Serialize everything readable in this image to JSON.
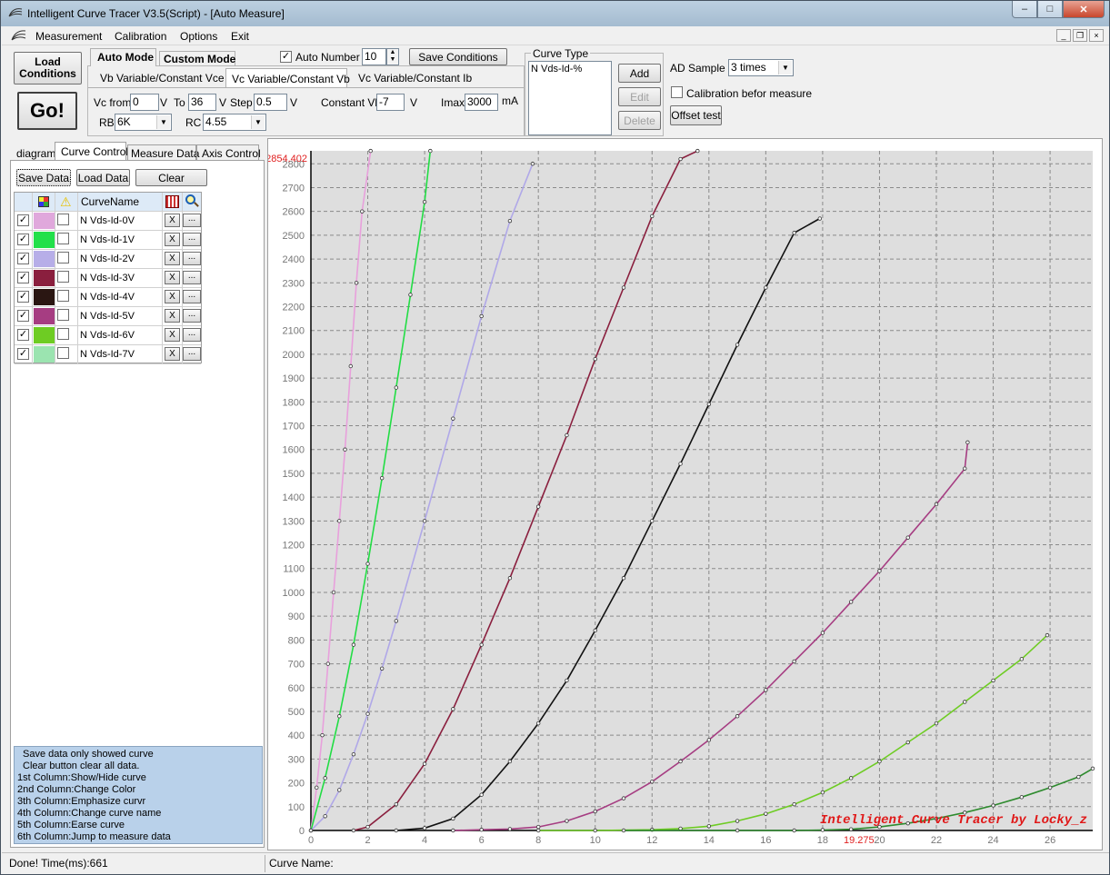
{
  "window": {
    "title": "Intelligent Curve Tracer V3.5(Script) - [Auto Measure]"
  },
  "menu": [
    "Measurement",
    "Calibration",
    "Options",
    "Exit"
  ],
  "toolbar": {
    "load_conditions": "Load Conditions",
    "go": "Go!",
    "auto_mode": "Auto Mode",
    "custom_mode": "Custom Mode",
    "auto_number_label": "Auto Number",
    "auto_number_checked": true,
    "auto_number_value": "10",
    "save_conditions": "Save Conditions",
    "subtabs": [
      "Vb Variable/Constant Vce",
      "Vc Variable/Constant Vb",
      "Vc Variable/Constant Ib"
    ],
    "vc_from_label": "Vc from",
    "vc_from": "0",
    "v1": "V",
    "to_label": "To",
    "to": "36",
    "v2": "V",
    "step_label": "Step",
    "step": "0.5",
    "v3": "V",
    "constant_vb_label": "Constant Vb",
    "constant_vb": "-7",
    "v4": "V",
    "imax_label": "Imax",
    "imax": "3000",
    "ma": "mA",
    "rb_label": "RB",
    "rb": "6K",
    "rc_label": "RC",
    "rc": "4.55"
  },
  "curve_type": {
    "label": "Curve Type",
    "items": [
      "N Vds-Id-%"
    ],
    "add": "Add",
    "edit": "Edit",
    "delete": "Delete"
  },
  "ad_sample": {
    "label": "AD Sample",
    "value": "3 times"
  },
  "calibration": {
    "label": "Calibration befor measure",
    "checked": false
  },
  "offset_test": "Offset test",
  "left_tabs": [
    "diagram",
    "Curve Control",
    "Measure Data",
    "Axis Control"
  ],
  "left_buttons": {
    "save": "Save Data",
    "load": "Load Data",
    "clear": "Clear"
  },
  "grid_header": {
    "name": "CurveName"
  },
  "curves": [
    {
      "name": "N Vds-Id-0V",
      "color": "#e0a8dc"
    },
    {
      "name": "N Vds-Id-1V",
      "color": "#22e04a"
    },
    {
      "name": "N Vds-Id-2V",
      "color": "#b7aee8"
    },
    {
      "name": "N Vds-Id-3V",
      "color": "#8a1f3e"
    },
    {
      "name": "N Vds-Id-4V",
      "color": "#2a1612"
    },
    {
      "name": "N Vds-Id-5V",
      "color": "#a63d82"
    },
    {
      "name": "N Vds-Id-6V",
      "color": "#6ecc23"
    },
    {
      "name": "N Vds-Id-7V",
      "color": "#9be4b0"
    }
  ],
  "grid_buttons": {
    "erase": "X",
    "jump": "..."
  },
  "help_text": [
    "Save data only showed curve",
    "Clear button clear all data.",
    "1st Column:Show/Hide curve",
    "2nd Column:Change Color",
    "3th Column:Emphasize curvr",
    "4th Column:Change curve name",
    "5th Column:Earse curve",
    "6th Column:Jump to measure data"
  ],
  "status": {
    "left": "Done!  Time(ms):661",
    "right": "Curve Name:"
  },
  "chart_data": {
    "type": "line",
    "xlim": [
      0,
      27.5
    ],
    "ylim": [
      0,
      2854.402
    ],
    "ymax_label": "2854.402",
    "cursor_x_label": "19.275",
    "watermark": "Intelligent Curve Tracer by Locky_z",
    "x_ticks": [
      0,
      2,
      4,
      6,
      8,
      10,
      12,
      14,
      16,
      18,
      20,
      22,
      24,
      26
    ],
    "y_ticks": [
      0,
      100,
      200,
      300,
      400,
      500,
      600,
      700,
      800,
      900,
      1000,
      1100,
      1200,
      1300,
      1400,
      1500,
      1600,
      1700,
      1800,
      1900,
      2000,
      2100,
      2200,
      2300,
      2400,
      2500,
      2600,
      2700,
      2800
    ],
    "series": [
      {
        "color": "#e8a0dc",
        "points": [
          [
            0,
            0
          ],
          [
            0.2,
            180
          ],
          [
            0.4,
            400
          ],
          [
            0.6,
            700
          ],
          [
            0.8,
            1000
          ],
          [
            1,
            1300
          ],
          [
            1.2,
            1600
          ],
          [
            1.4,
            1950
          ],
          [
            1.6,
            2300
          ],
          [
            1.8,
            2600
          ],
          [
            2.1,
            2854
          ]
        ]
      },
      {
        "color": "#22dd44",
        "points": [
          [
            0,
            0
          ],
          [
            0.5,
            220
          ],
          [
            1,
            480
          ],
          [
            1.5,
            780
          ],
          [
            2,
            1120
          ],
          [
            2.5,
            1480
          ],
          [
            3,
            1860
          ],
          [
            3.5,
            2250
          ],
          [
            4,
            2640
          ],
          [
            4.2,
            2854
          ]
        ]
      },
      {
        "color": "#b0a8e8",
        "points": [
          [
            0,
            0
          ],
          [
            0.5,
            60
          ],
          [
            1,
            170
          ],
          [
            1.5,
            320
          ],
          [
            2,
            490
          ],
          [
            2.5,
            680
          ],
          [
            3,
            880
          ],
          [
            4,
            1300
          ],
          [
            5,
            1730
          ],
          [
            6,
            2160
          ],
          [
            7,
            2560
          ],
          [
            7.8,
            2800
          ]
        ]
      },
      {
        "color": "#8a1f3e",
        "points": [
          [
            1.5,
            0
          ],
          [
            2,
            15
          ],
          [
            3,
            110
          ],
          [
            4,
            280
          ],
          [
            5,
            510
          ],
          [
            6,
            780
          ],
          [
            7,
            1060
          ],
          [
            8,
            1360
          ],
          [
            9,
            1660
          ],
          [
            10,
            1980
          ],
          [
            11,
            2280
          ],
          [
            12,
            2580
          ],
          [
            13,
            2820
          ],
          [
            13.6,
            2854
          ]
        ]
      },
      {
        "color": "#111111",
        "points": [
          [
            3,
            0
          ],
          [
            4,
            10
          ],
          [
            5,
            50
          ],
          [
            6,
            150
          ],
          [
            7,
            290
          ],
          [
            8,
            450
          ],
          [
            9,
            630
          ],
          [
            10,
            840
          ],
          [
            11,
            1060
          ],
          [
            12,
            1300
          ],
          [
            13,
            1540
          ],
          [
            14,
            1790
          ],
          [
            15,
            2040
          ],
          [
            16,
            2280
          ],
          [
            17,
            2510
          ],
          [
            17.9,
            2570
          ]
        ]
      },
      {
        "color": "#a63d82",
        "points": [
          [
            5,
            0
          ],
          [
            6,
            3
          ],
          [
            7,
            6
          ],
          [
            8,
            15
          ],
          [
            9,
            40
          ],
          [
            10,
            80
          ],
          [
            11,
            135
          ],
          [
            12,
            205
          ],
          [
            13,
            290
          ],
          [
            14,
            380
          ],
          [
            15,
            480
          ],
          [
            16,
            590
          ],
          [
            17,
            710
          ],
          [
            18,
            830
          ],
          [
            19,
            960
          ],
          [
            20,
            1090
          ],
          [
            21,
            1230
          ],
          [
            22,
            1370
          ],
          [
            23,
            1520
          ],
          [
            23.1,
            1630
          ]
        ]
      },
      {
        "color": "#6ecc23",
        "points": [
          [
            8,
            0
          ],
          [
            10,
            0
          ],
          [
            12,
            3
          ],
          [
            13,
            8
          ],
          [
            14,
            18
          ],
          [
            15,
            40
          ],
          [
            16,
            70
          ],
          [
            17,
            110
          ],
          [
            18,
            160
          ],
          [
            19,
            220
          ],
          [
            20,
            290
          ],
          [
            21,
            370
          ],
          [
            22,
            450
          ],
          [
            23,
            540
          ],
          [
            24,
            630
          ],
          [
            25,
            720
          ],
          [
            25.9,
            820
          ]
        ]
      },
      {
        "color": "#2e8b2e",
        "points": [
          [
            11,
            0
          ],
          [
            15,
            0
          ],
          [
            17,
            0
          ],
          [
            18,
            2
          ],
          [
            19,
            5
          ],
          [
            20,
            15
          ],
          [
            21,
            30
          ],
          [
            22,
            50
          ],
          [
            23,
            75
          ],
          [
            24,
            105
          ],
          [
            25,
            140
          ],
          [
            26,
            180
          ],
          [
            27,
            225
          ],
          [
            27.5,
            260
          ]
        ]
      }
    ]
  }
}
